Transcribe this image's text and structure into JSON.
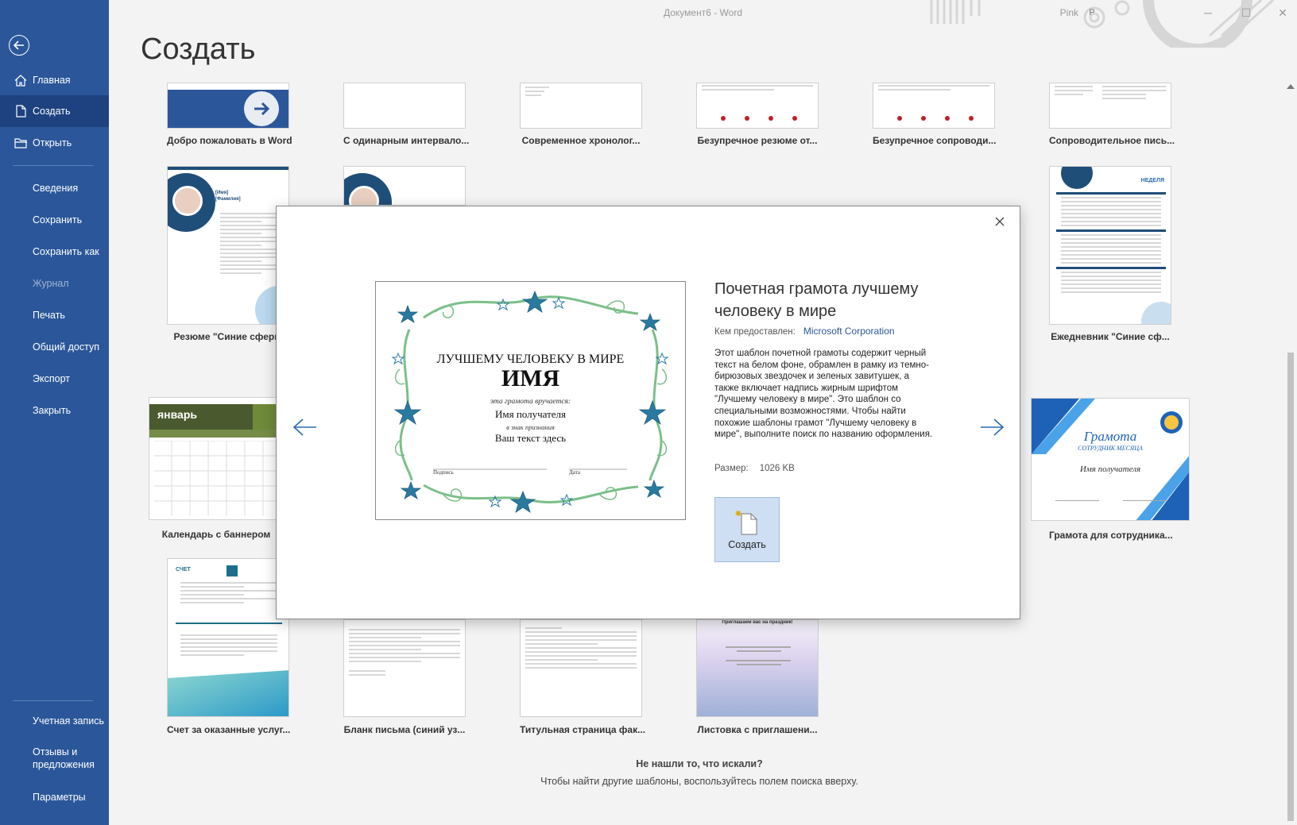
{
  "window": {
    "title": "Документ6  -  Word",
    "user_name": "Pink",
    "user_initial": "P"
  },
  "sidebar": {
    "items": [
      {
        "label": "Главная"
      },
      {
        "label": "Создать"
      },
      {
        "label": "Открыть"
      },
      {
        "label": "Сведения"
      },
      {
        "label": "Сохранить"
      },
      {
        "label": "Сохранить как"
      },
      {
        "label": "Журнал"
      },
      {
        "label": "Печать"
      },
      {
        "label": "Общий доступ"
      },
      {
        "label": "Экспорт"
      },
      {
        "label": "Закрыть"
      },
      {
        "label": "Учетная запись"
      },
      {
        "label": "Отзывы и предложения"
      },
      {
        "label": "Параметры"
      }
    ]
  },
  "page": {
    "title": "Создать"
  },
  "templates": [
    "Добро пожаловать в Word",
    "С одинарным интервало...",
    "Современное хронолог...",
    "Безупречное резюме от...",
    "Безупречное сопроводи...",
    "Сопроводительное пись...",
    "Резюме \"Синие сферы",
    "Ежедневник \"Синие сф...",
    "Календарь с баннером",
    "Грамота для сотрудника...",
    "Счет за оказанные услуг...",
    "Бланк письма (синий уз...",
    "Титульная страница фак...",
    "Листовка с приглашени..."
  ],
  "thumb_text": {
    "resume_name": "[Имя]",
    "resume_surname": "[Фамилия]",
    "planner_week": "НЕДЕЛЯ",
    "calendar_month": "январь",
    "invoice": "СЧЕТ",
    "award_title": "Грамота",
    "award_sub": "СОТРУДНИК МЕСЯЦА",
    "award_name": "Имя получателя",
    "flyer_top": "Приглашаем вас на праздник!"
  },
  "footer": {
    "heading": "Не нашли то, что искали?",
    "text": "Чтобы найти другие шаблоны, воспользуйтесь полем поиска вверху."
  },
  "modal": {
    "title": "Почетная грамота лучшему человеку в мире",
    "provider_label": "Кем предоставлен:",
    "provider": "Microsoft Corporation",
    "description": "Этот шаблон почетной грамоты содержит черный текст на белом фоне, обрамлен в рамку из темно-бирюзовых звездочек и зеленых завитушек, а также включает надпись жирным шрифтом \"Лучшему человеку в мире\". Это шаблон со специальными возможностями. Чтобы найти похожие шаблоны грамот \"Лучшему человеку в мире\", выполните поиск по названию оформления.",
    "size_label": "Размер:",
    "size_value": "1026 KB",
    "create_label": "Создать",
    "certificate": {
      "heading": "ЛУЧШЕМУ ЧЕЛОВЕКУ В МИРЕ",
      "name": "ИМЯ",
      "awarded_to": "эта грамота вручается:",
      "recipient": "Имя получателя",
      "in_honor": "в знак признания",
      "text": "Ваш текст здесь",
      "signature": "Подпись",
      "date": "Дата"
    }
  },
  "colors": {
    "sidebar": "#2b579a",
    "sidebar_active": "#1e4180",
    "accent_teal": "#1f6f8b",
    "frame_green": "#7cbf8a",
    "create_button": "#cfdff3"
  }
}
